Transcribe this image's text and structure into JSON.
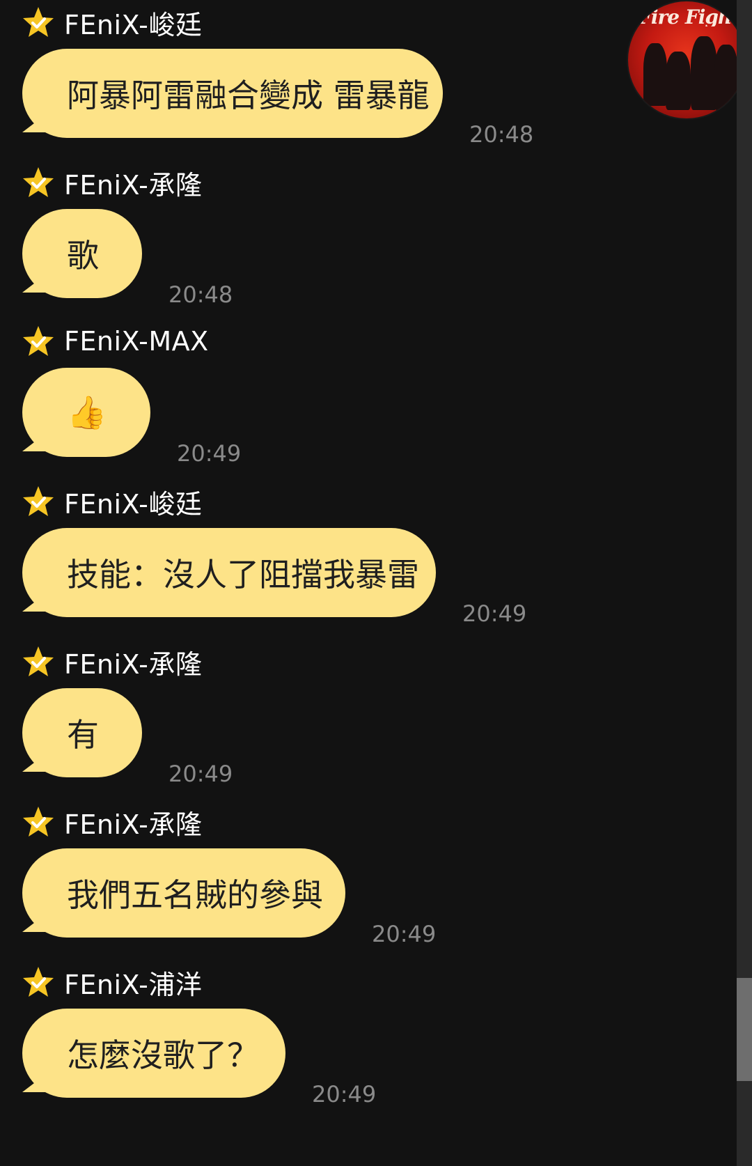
{
  "colors": {
    "background": "#121212",
    "bubble": "#fde388",
    "bubble_text": "#1f1f1f",
    "sender_text": "#ffffff",
    "time_text": "#8a8a8a",
    "star": "#f6c524"
  },
  "avatar": {
    "icon": "group-avatar",
    "caption": "Fire Fighter"
  },
  "messages": [
    {
      "sender": "FEniX-峻廷",
      "text": "阿暴阿雷融合變成 雷暴龍",
      "time": "20:48"
    },
    {
      "sender": "FEniX-承隆",
      "text": "歌",
      "time": "20:48"
    },
    {
      "sender": "FEniX-MAX",
      "text": "👍",
      "time": "20:49",
      "icon": "thumbs-up-icon"
    },
    {
      "sender": "FEniX-峻廷",
      "text": "技能：沒人了阻擋我暴雷",
      "time": "20:49"
    },
    {
      "sender": "FEniX-承隆",
      "text": "有",
      "time": "20:49"
    },
    {
      "sender": "FEniX-承隆",
      "text": "我們五名賊的參與",
      "time": "20:49"
    },
    {
      "sender": "FEniX-浦洋",
      "text": "怎麼沒歌了？",
      "time": "20:49"
    }
  ]
}
